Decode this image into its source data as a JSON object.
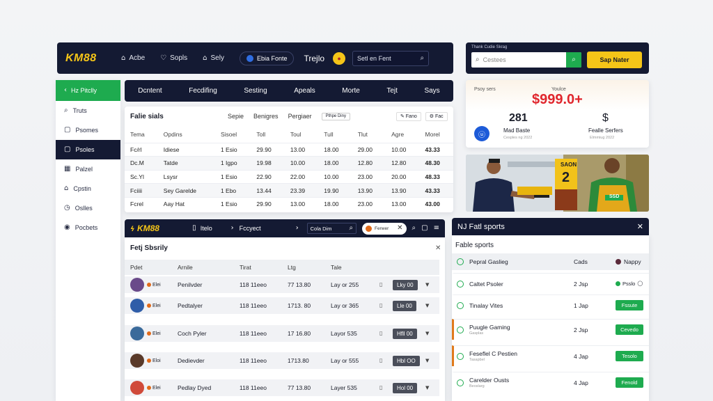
{
  "header": {
    "logo": "KM88",
    "nav": [
      {
        "icon": "home-icon",
        "label": "Acbe"
      },
      {
        "icon": "heart-icon",
        "label": "Sopls"
      },
      {
        "icon": "home-alt-icon",
        "label": "Sely"
      }
    ],
    "pill_label": "Ebia Fonte",
    "brand_word": "Trejlo",
    "search_placeholder": "Setl en Fent"
  },
  "right_bar": {
    "caption": "Thank Cudie Skrag",
    "search_placeholder": "Cestees",
    "signup_label": "Sap Nater"
  },
  "sidebar": {
    "items": [
      {
        "icon": "chevron-left-icon",
        "label": "Hz Pitclly"
      },
      {
        "icon": "search-icon",
        "label": "Truts"
      },
      {
        "icon": "doc-icon",
        "label": "Psomes"
      },
      {
        "icon": "doc-icon",
        "label": "Psoles"
      },
      {
        "icon": "grid-icon",
        "label": "Palzel"
      },
      {
        "icon": "lock-icon",
        "label": "Cpstin"
      },
      {
        "icon": "clock-icon",
        "label": "Oslles"
      },
      {
        "icon": "pin-icon",
        "label": "Pocbets"
      }
    ]
  },
  "tabs": [
    "Dcntent",
    "Fecdifing",
    "Sesting",
    "Apeals",
    "Morte",
    "Tejt",
    "Says"
  ],
  "main_table": {
    "title": "Falie sials",
    "filters": [
      "Sepie",
      "Benigres",
      "Pergiaer"
    ],
    "box_label": "Pthpe Diny",
    "actions": [
      "Fano",
      "Fac"
    ],
    "columns": [
      "Tema",
      "Opdins",
      "Sisoel",
      "Toll",
      "Toul",
      "Tull",
      "Tlut",
      "Agre",
      "Morel"
    ],
    "rows": [
      [
        "Fc/rl",
        "Idiese",
        "1 Esio",
        "29.90",
        "13.00",
        "18.00",
        "29.00",
        "10.00",
        "43.33"
      ],
      [
        "Dc.M",
        "Tatde",
        "1 Igpo",
        "19.98",
        "10.00",
        "18.00",
        "12.80",
        "12.80",
        "48.30"
      ],
      [
        "Sc.Yl",
        "Lsysr",
        "1 Esio",
        "22.90",
        "22.00",
        "10.00",
        "23.00",
        "20.00",
        "48.33"
      ],
      [
        "Fciiii",
        "Sey Garelde",
        "1 Ebo",
        "13.44",
        "23.39",
        "19.90",
        "13.90",
        "13.90",
        "43.33"
      ],
      [
        "Fcrel",
        "Aay Hat",
        "1 Esio",
        "29.90",
        "13.00",
        "18.00",
        "23.00",
        "13.00",
        "43.00"
      ]
    ]
  },
  "promo": {
    "label_left": "Psoy sers",
    "label_right": "Youlce",
    "amount": "$999.0+",
    "stat1_value": "281",
    "stat1_label": "Mad Baste",
    "stat1_sub": "Cesples ng 2022",
    "stat2_value": "$",
    "stat2_label": "Fealle Serfers",
    "stat2_sub": "Elmmiug 2022"
  },
  "banner": {
    "sign_text": "SAON",
    "sign_number": "2",
    "apron_text": "SSD"
  },
  "window2": {
    "logo": "KM88",
    "nav": [
      "Itelo",
      "Fccyect"
    ],
    "search_text": "Cola Dim",
    "pill_text": "Ferwer",
    "title": "Fetj Sbsrily",
    "columns": [
      "Pdet",
      "Arnile",
      "Tirat",
      "Ltg",
      "Tale"
    ],
    "rows": [
      {
        "tag": "Elei",
        "name": "Penilvder",
        "time": "118 11eeo",
        "date": "77 13.80",
        "info": "Lay or 255",
        "btn": "Lky 00"
      },
      {
        "tag": "Elei",
        "name": "Pedtalyer",
        "time": "118 11eeo",
        "date": "1713. 80",
        "info": "Lay or 365",
        "btn": "Lle 00"
      },
      {
        "tag": "Elei",
        "name": "Coch Pyler",
        "time": "118 11eeo",
        "date": "17 16.80",
        "info": "Layor 535",
        "btn": "Hfll 00"
      },
      {
        "tag": "Eloi",
        "name": "Dedievder",
        "time": "118 11eeo",
        "date": "1713.80",
        "info": "Lay or 555",
        "btn": "Hbl OO"
      },
      {
        "tag": "Elei",
        "name": "Pedlay Dyed",
        "time": "118 11eeo",
        "date": "77 13.80",
        "info": "Layer 535",
        "btn": "Hol 00"
      }
    ]
  },
  "sports": {
    "header": "NJ Fatl sports",
    "title": "Fable sports",
    "col_name": "Pepral Gaslieg",
    "col_count": "Cads",
    "col_status": "Nappy",
    "rows": [
      {
        "name": "Caltet Psoler",
        "sub": "",
        "count": "2 Jsp",
        "action": "Psslo"
      },
      {
        "name": "Tinalay Vites",
        "sub": "",
        "count": "1 Jap",
        "action": "Fssute"
      },
      {
        "name": "Puugle Gaming",
        "sub": "Gasplas",
        "count": "2 Jsp",
        "action": "Cevedo"
      },
      {
        "name": "Feseflel C Pestien",
        "sub": "Tasapbel",
        "count": "4 Jap",
        "action": "Tesolo"
      },
      {
        "name": "Carelder Ousts",
        "sub": "Beoslarg",
        "count": "4 Jap",
        "action": "Fenold"
      }
    ]
  }
}
